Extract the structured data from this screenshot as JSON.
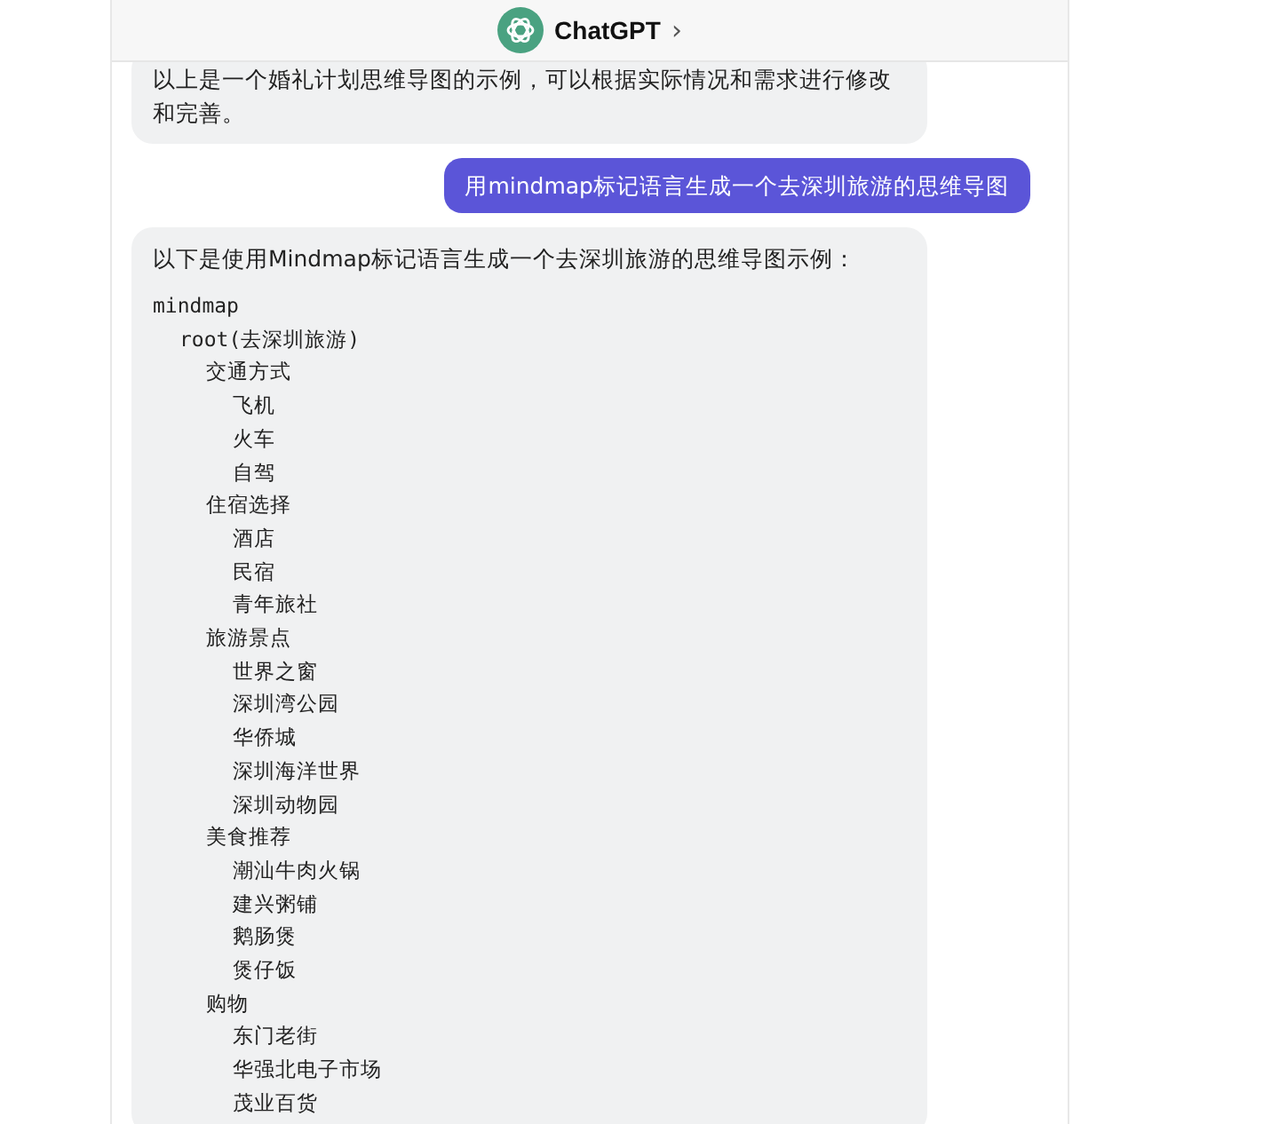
{
  "header": {
    "title": "ChatGPT",
    "chevron": "›"
  },
  "messages": [
    {
      "kind": "assistant_text",
      "text": "以上是一个婚礼计划思维导图的示例，可以根据实际情况和需求进行修改和完善。"
    },
    {
      "kind": "user_text",
      "text": "用mindmap标记语言生成一个去深圳旅游的思维导图"
    },
    {
      "kind": "assistant_code",
      "text": "以下是使用Mindmap标记语言生成一个去深圳旅游的思维导图示例：",
      "code": [
        {
          "text": "mindmap",
          "children": [
            {
              "text": "root(去深圳旅游)",
              "children": [
                {
                  "text": "交通方式",
                  "children": [
                    {
                      "text": "飞机"
                    },
                    {
                      "text": "火车"
                    },
                    {
                      "text": "自驾"
                    }
                  ]
                },
                {
                  "text": "住宿选择",
                  "children": [
                    {
                      "text": "酒店"
                    },
                    {
                      "text": "民宿"
                    },
                    {
                      "text": "青年旅社"
                    }
                  ]
                },
                {
                  "text": "旅游景点",
                  "children": [
                    {
                      "text": "世界之窗"
                    },
                    {
                      "text": "深圳湾公园"
                    },
                    {
                      "text": "华侨城"
                    },
                    {
                      "text": "深圳海洋世界"
                    },
                    {
                      "text": "深圳动物园"
                    }
                  ]
                },
                {
                  "text": "美食推荐",
                  "children": [
                    {
                      "text": "潮汕牛肉火锅"
                    },
                    {
                      "text": "建兴粥铺"
                    },
                    {
                      "text": "鹅肠煲"
                    },
                    {
                      "text": "煲仔饭"
                    }
                  ]
                },
                {
                  "text": "购物",
                  "children": [
                    {
                      "text": "东门老街"
                    },
                    {
                      "text": "华强北电子市场"
                    },
                    {
                      "text": "茂业百货"
                    }
                  ]
                }
              ]
            }
          ]
        }
      ]
    }
  ]
}
